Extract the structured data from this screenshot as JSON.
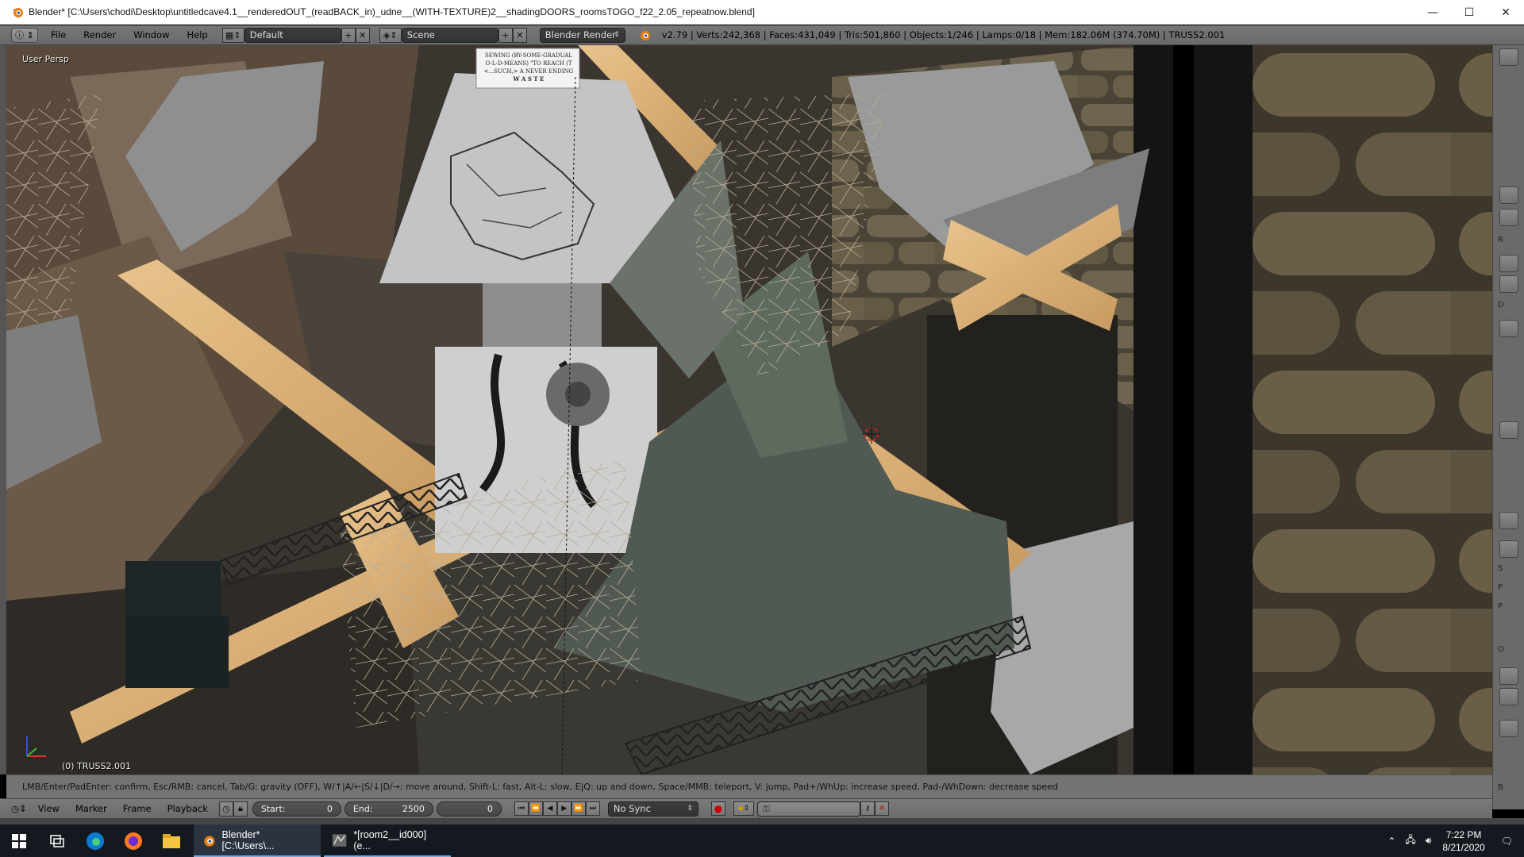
{
  "window": {
    "title": "Blender* [C:\\Users\\chodi\\Desktop\\untitledcave4.1__renderedOUT_(readBACK_in)_udne__(WITH-TEXTURE)2__shadingDOORS_roomsTOGO_f22_2.05_repeatnow.blend]",
    "minimize_glyph": "—",
    "maximize_glyph": "☐",
    "close_glyph": "✕"
  },
  "info_header": {
    "editor_type_icon": "info-icon",
    "menus": [
      "File",
      "Render",
      "Window",
      "Help"
    ],
    "layout_dropdown": "Default",
    "scene_dropdown": "Scene",
    "render_engine": "Blender Render",
    "stats": "v2.79 | Verts:242,368 | Faces:431,049 | Tris:501,860 | Objects:1/246 | Lamps:0/18 | Mem:182.06M (374.70M) | TRUSS2.001"
  },
  "viewport": {
    "view_label": "User Persp",
    "object_label": "(0) TRUSS2.001",
    "sign_text": [
      "SEWING (BY-SOME-GRADUAL",
      "O-L-D-MEANS) \"TO REACH (T",
      "<...SUCH,> A NEVER ENDING",
      "W A S T E"
    ]
  },
  "helpline": {
    "text": "LMB/Enter/PadEnter: confirm, Esc/RMB: cancel, Tab/G: gravity (OFF), W/↑|A/←|S/↓|D/→: move around, Shift-L: fast, Alt-L: slow, E|Q: up and down, Space/MMB: teleport, V: jump, Pad+/WhUp: increase speed, Pad-/WhDown: decrease speed"
  },
  "timeline": {
    "menus": [
      "View",
      "Marker",
      "Frame",
      "Playback"
    ],
    "start_label": "Start:",
    "start_value": "0",
    "end_label": "End:",
    "end_value": "2500",
    "current_frame": "0",
    "sync": "No Sync"
  },
  "taskbar": {
    "apps": [
      {
        "label": "Blender* [C:\\Users\\...",
        "active": true
      },
      {
        "label": "*[room2__id000] (e...",
        "active": false
      }
    ],
    "time": "7:22 PM",
    "date": "8/21/2020"
  },
  "right_toolbar": {
    "markers": [
      "R",
      "D",
      "S",
      "P",
      "P",
      "O",
      "B"
    ]
  }
}
